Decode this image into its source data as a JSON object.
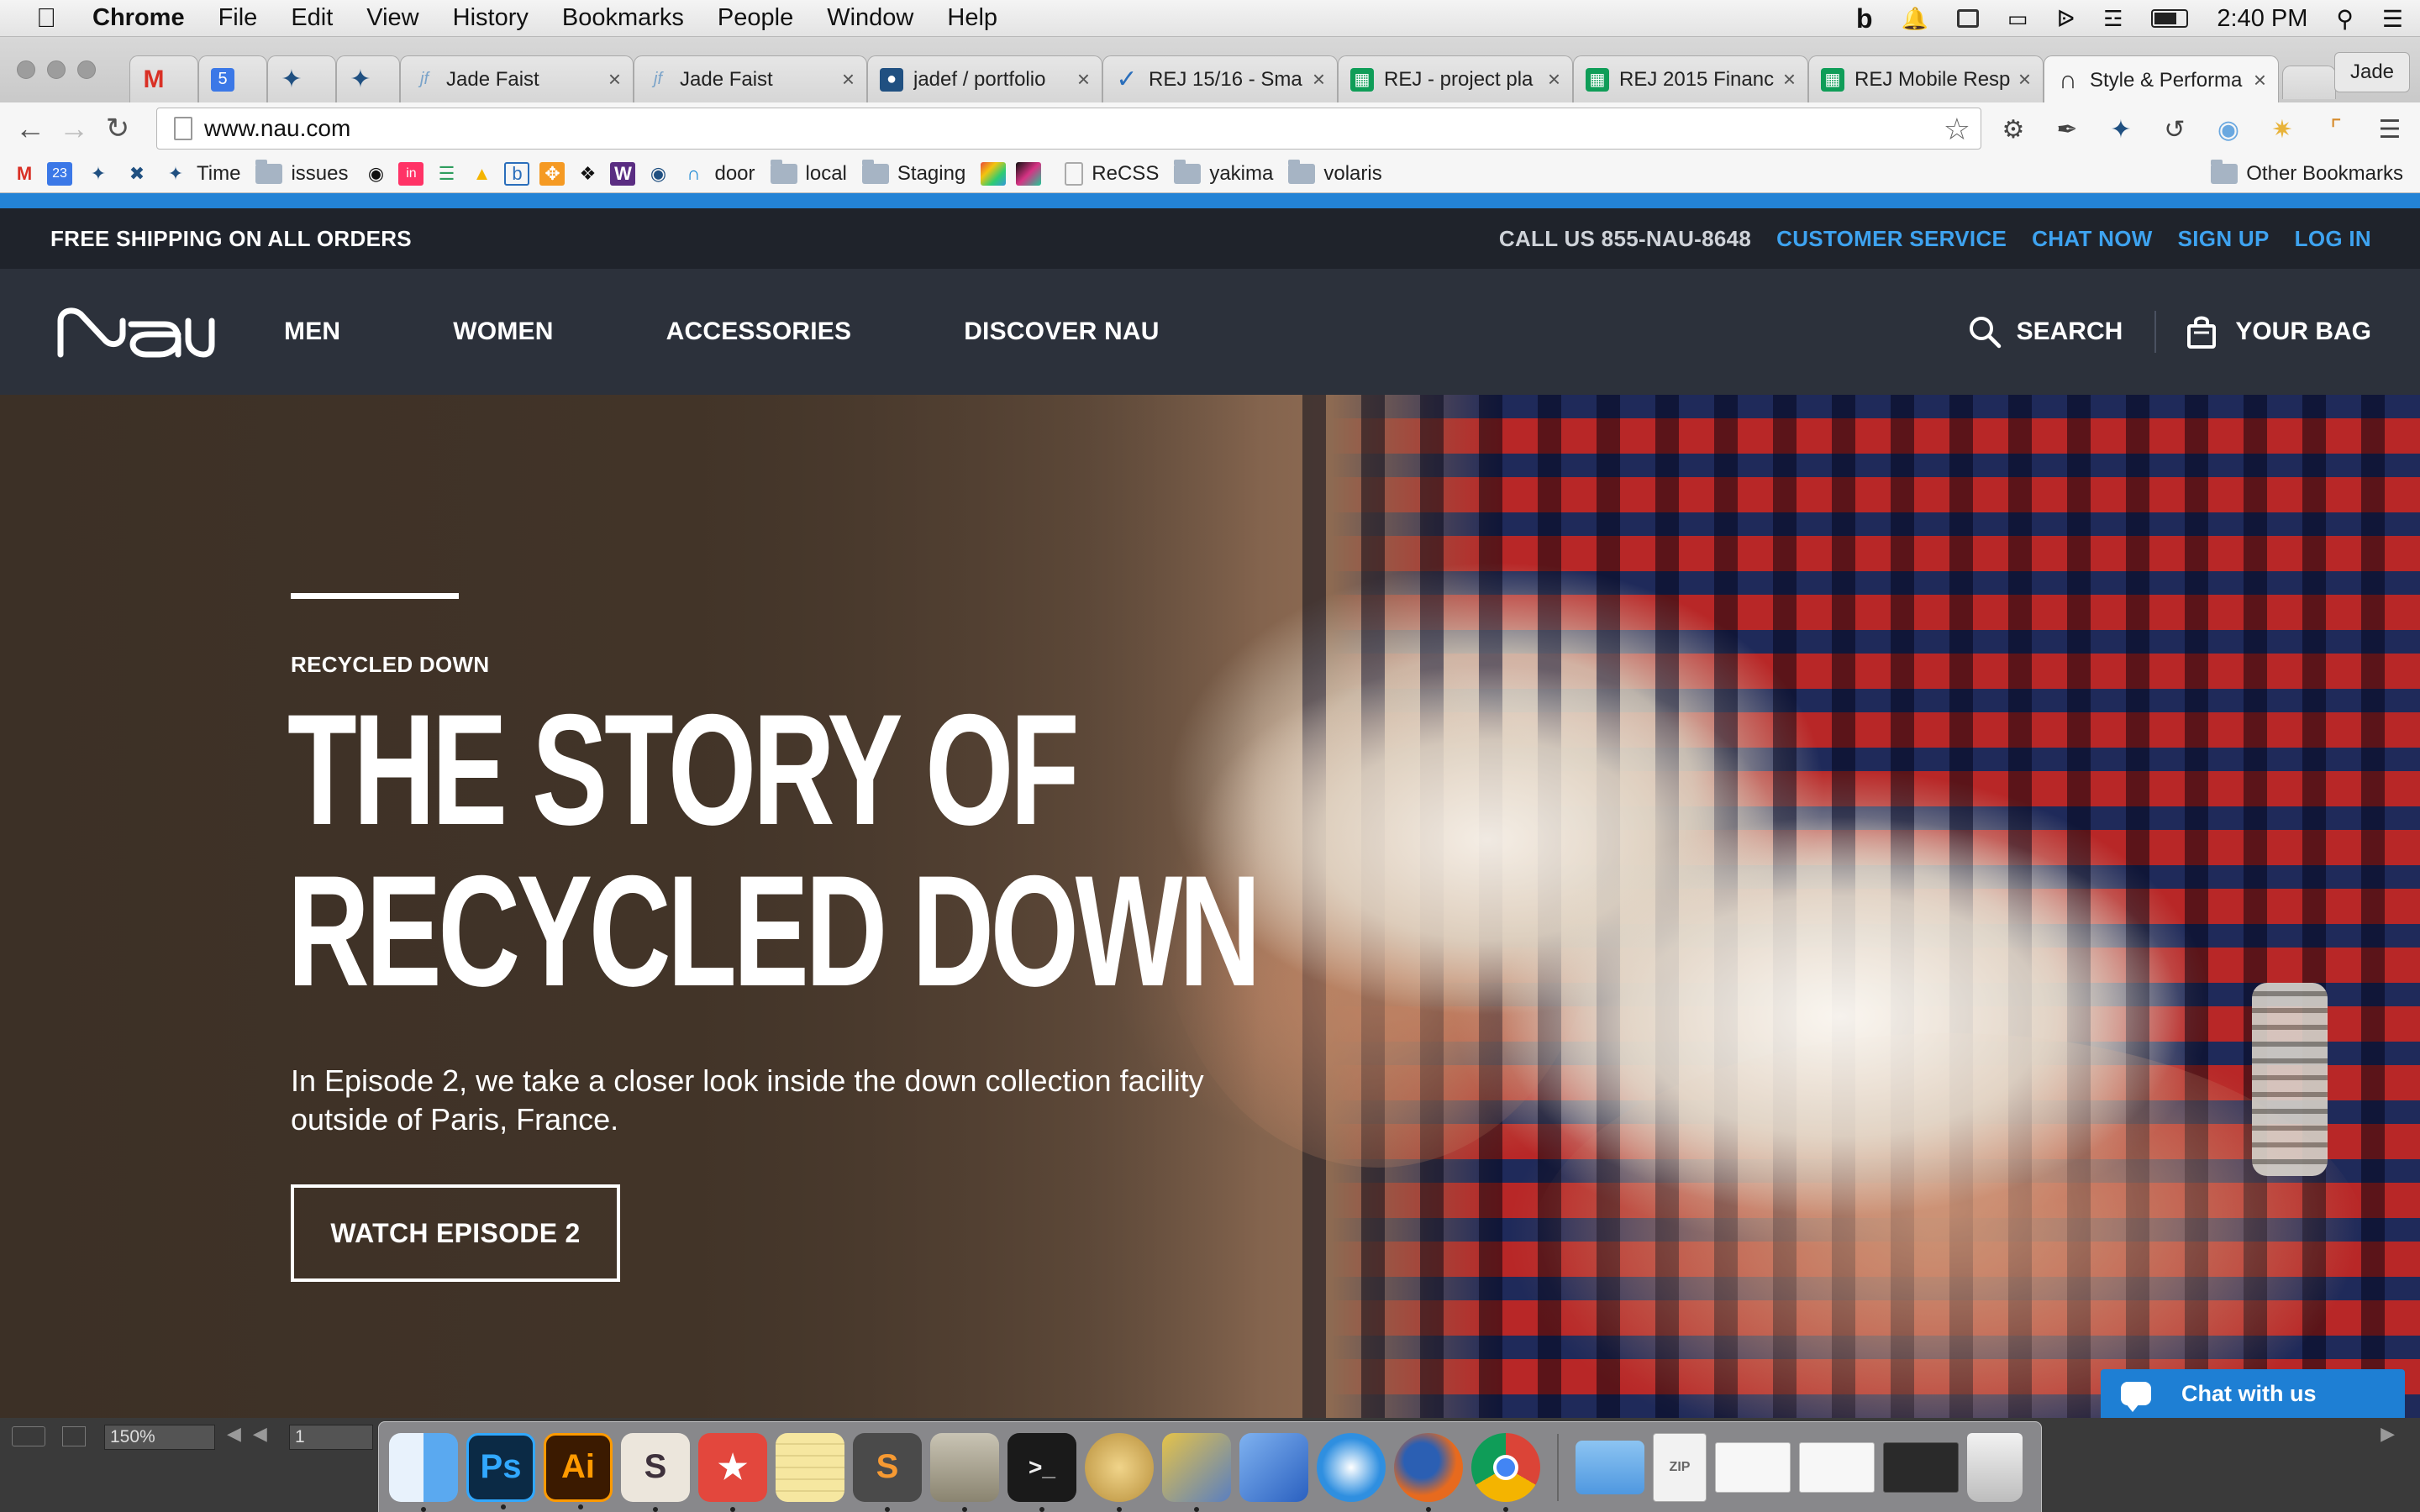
{
  "menubar": {
    "app_name": "Chrome",
    "menus": [
      "File",
      "Edit",
      "View",
      "History",
      "Bookmarks",
      "People",
      "Window",
      "Help"
    ],
    "clock": "2:40 PM"
  },
  "tabs": [
    {
      "label": "",
      "icon": "gmail-icon",
      "color": "#d93025"
    },
    {
      "label": "",
      "icon": "calendar-icon",
      "color": "#3b78e7"
    },
    {
      "label": "",
      "icon": "jira-icon",
      "color": "#205081"
    },
    {
      "label": "",
      "icon": "jira-icon",
      "color": "#205081"
    },
    {
      "label": "Jade Faist",
      "icon": "jf-icon",
      "color": "#7aa3c9"
    },
    {
      "label": "Jade Faist",
      "icon": "jf-icon",
      "color": "#7aa3c9"
    },
    {
      "label": "jadef / portfolio",
      "icon": "bitbucket-icon",
      "color": "#205081"
    },
    {
      "label": "REJ 15/16 - Sma",
      "icon": "check-icon",
      "color": "#2a6ebb"
    },
    {
      "label": "REJ - project pla",
      "icon": "sheets-icon",
      "color": "#0f9d58"
    },
    {
      "label": "REJ 2015 Financ",
      "icon": "sheets-icon",
      "color": "#0f9d58"
    },
    {
      "label": "REJ Mobile Resp",
      "icon": "sheets-icon",
      "color": "#0f9d58"
    },
    {
      "label": "Style & Performa",
      "icon": "door-icon",
      "color": "#333333"
    }
  ],
  "profile_name": "Jade",
  "url": "www.nau.com",
  "bookmarks": [
    {
      "label": "",
      "icon": "gmail-icon"
    },
    {
      "label": "",
      "icon": "calendar-icon"
    },
    {
      "label": "",
      "icon": "jira-icon"
    },
    {
      "label": "",
      "icon": "tools-icon"
    },
    {
      "label": "Time",
      "icon": "jira-icon"
    },
    {
      "label": "issues",
      "icon": "folder-icon"
    },
    {
      "label": "",
      "icon": "github-icon"
    },
    {
      "label": "",
      "icon": "invision-icon"
    },
    {
      "label": "",
      "icon": "bars-icon"
    },
    {
      "label": "",
      "icon": "drive-icon"
    },
    {
      "label": "",
      "icon": "b-icon"
    },
    {
      "label": "",
      "icon": "orange-icon"
    },
    {
      "label": "",
      "icon": "bird-icon"
    },
    {
      "label": "",
      "icon": "w-icon"
    },
    {
      "label": "",
      "icon": "bitbucket-icon"
    },
    {
      "label": "door",
      "icon": "door-icon"
    },
    {
      "label": "local",
      "icon": "folder-icon"
    },
    {
      "label": "Staging",
      "icon": "folder-icon"
    },
    {
      "label": "",
      "icon": "color-icon"
    },
    {
      "label": "",
      "icon": "color-icon"
    },
    {
      "label": "ReCSS",
      "icon": "page-icon"
    },
    {
      "label": "yakima",
      "icon": "folder-icon"
    },
    {
      "label": "volaris",
      "icon": "folder-icon"
    }
  ],
  "other_bookmarks": "Other Bookmarks",
  "site": {
    "shipping": "FREE SHIPPING ON ALL ORDERS",
    "call": "CALL US 855-NAU-8648",
    "links": [
      "CUSTOMER SERVICE",
      "CHAT NOW",
      "SIGN UP",
      "LOG IN"
    ],
    "logo_text": "nau",
    "nav": [
      "MEN",
      "WOMEN",
      "ACCESSORIES",
      "DISCOVER NAU"
    ],
    "search": "SEARCH",
    "bag": "YOUR BAG",
    "accent": "#3ea3f0"
  },
  "hero": {
    "eyebrow": "RECYCLED DOWN",
    "title_line1": "THE STORY OF",
    "title_line2": "RECYCLED DOWN",
    "description": "In Episode 2, we take a closer look inside the down collection facility outside of Paris, France.",
    "cta": "WATCH EPISODE 2"
  },
  "chat": "Chat with us",
  "psbar": {
    "zoom": "150%",
    "page": "1"
  },
  "dock": [
    {
      "name": "finder-icon",
      "label": "",
      "color": "#5aa9f0"
    },
    {
      "name": "photoshop-icon",
      "label": "Ps",
      "color": "#0b2a45"
    },
    {
      "name": "illustrator-icon",
      "label": "Ai",
      "color": "#3b1a00"
    },
    {
      "name": "slack-icon",
      "label": "S",
      "color": "#ece6dc"
    },
    {
      "name": "wunderlist-icon",
      "label": "★",
      "color": "#e3473d"
    },
    {
      "name": "notes-icon",
      "label": "",
      "color": "#f6e7a0"
    },
    {
      "name": "sublime-icon",
      "label": "S",
      "color": "#4a4a4a"
    },
    {
      "name": "transmit-icon",
      "label": "",
      "color": "#c9c4b4"
    },
    {
      "name": "terminal-icon",
      "label": ">_",
      "color": "#1a1a1a"
    },
    {
      "name": "sequel-icon",
      "label": "",
      "color": "#d6b564"
    },
    {
      "name": "transmit-truck-icon",
      "label": "",
      "color": "#e5c349"
    },
    {
      "name": "xcode-icon",
      "label": "",
      "color": "#3f7fd6"
    },
    {
      "name": "safari-icon",
      "label": "",
      "color": "#2f8fe0"
    },
    {
      "name": "firefox-icon",
      "label": "",
      "color": "#e76a1e"
    },
    {
      "name": "chrome-icon",
      "label": "",
      "color": "#db4437"
    },
    {
      "name": "folder-icon",
      "label": "",
      "color": "#6fb3ec"
    },
    {
      "name": "zip-icon",
      "label": "",
      "color": "#e8e8e8"
    },
    {
      "name": "doc-thumb-icon",
      "label": "",
      "color": "#f0f0f0"
    },
    {
      "name": "doc-thumb-icon",
      "label": "",
      "color": "#f0f0f0"
    },
    {
      "name": "window-thumb-icon",
      "label": "",
      "color": "#2a2a2a"
    },
    {
      "name": "trash-icon",
      "label": "",
      "color": "#d9d9d9"
    }
  ]
}
